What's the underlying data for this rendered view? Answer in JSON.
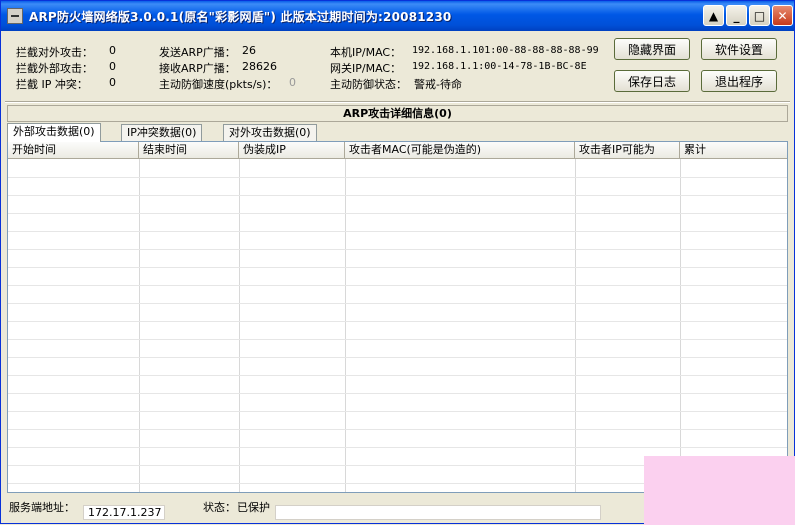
{
  "window": {
    "title": "ARP防火墙网络版3.0.0.1(原名\"彩影网盾\") 此版本过期时间为:20081230"
  },
  "info": {
    "blocked_outgoing_label": "拦截对外攻击：",
    "blocked_outgoing_value": "0",
    "blocked_external_label": "拦截外部攻击：",
    "blocked_external_value": "0",
    "blocked_ip_conflict_label": "拦截 IP 冲突：",
    "blocked_ip_conflict_value": "0",
    "send_broadcast_label": "发送ARP广播：",
    "send_broadcast_value": "26",
    "recv_broadcast_label": "接收ARP广播：",
    "recv_broadcast_value": "28626",
    "active_speed_label": "主动防御速度(pkts/s)：",
    "active_speed_value": "0",
    "local_ipmac_label": "本机IP/MAC：",
    "local_ipmac_value": "192.168.1.101:00-88-88-88-88-99",
    "gateway_ipmac_label": "网关IP/MAC：",
    "gateway_ipmac_value": "192.168.1.1:00-14-78-1B-BC-8E",
    "active_state_label": "主动防御状态：",
    "active_state_value": "警戒-待命"
  },
  "buttons": {
    "hide": "隐藏界面",
    "settings": "软件设置",
    "save_log": "保存日志",
    "exit": "退出程序"
  },
  "detail": {
    "header": "ARP攻击详细信息(0)"
  },
  "tabs": [
    {
      "label": "外部攻击数据(0)"
    },
    {
      "label": "IP冲突数据(0)"
    },
    {
      "label": "对外攻击数据(0)"
    }
  ],
  "columns": [
    {
      "label": "开始时间"
    },
    {
      "label": "结束时间"
    },
    {
      "label": "伪装成IP"
    },
    {
      "label": "攻击者MAC(可能是伪造的)"
    },
    {
      "label": "攻击者IP可能为"
    },
    {
      "label": "累计"
    }
  ],
  "status": {
    "server_label": "服务端地址：",
    "server_value": "172.17.1.237",
    "state_label": "状态：",
    "state_value": "已保护"
  }
}
